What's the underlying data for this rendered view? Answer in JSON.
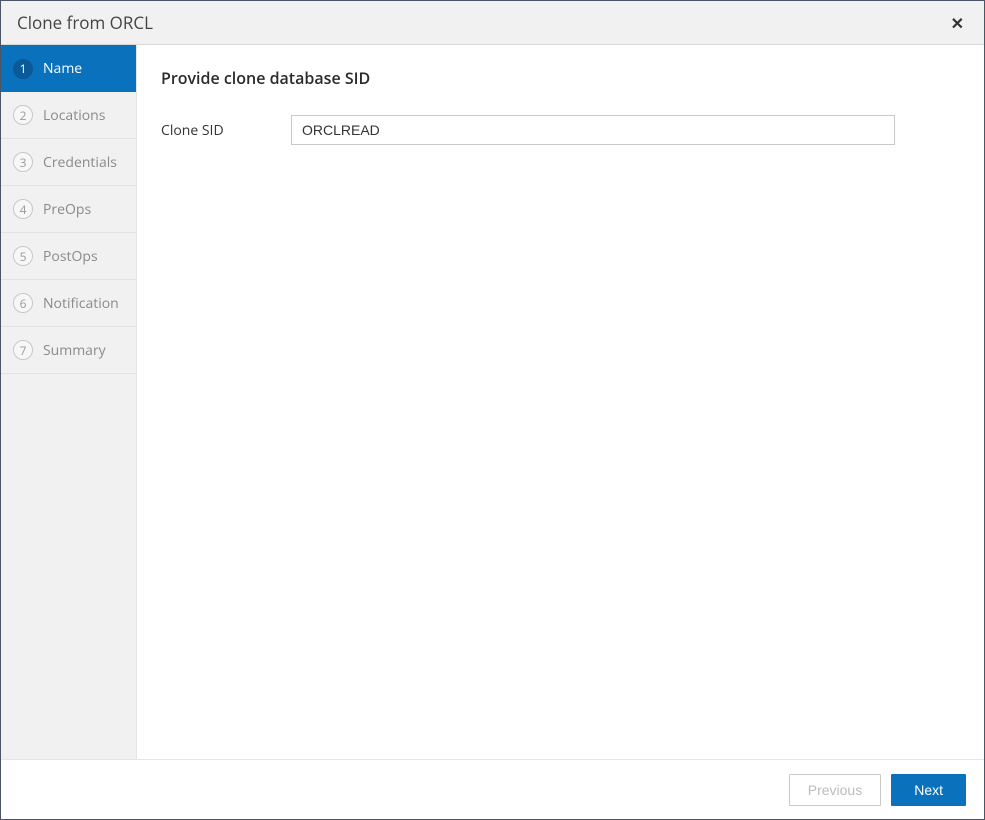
{
  "header": {
    "title": "Clone from ORCL"
  },
  "sidebar": {
    "items": [
      {
        "num": "1",
        "label": "Name"
      },
      {
        "num": "2",
        "label": "Locations"
      },
      {
        "num": "3",
        "label": "Credentials"
      },
      {
        "num": "4",
        "label": "PreOps"
      },
      {
        "num": "5",
        "label": "PostOps"
      },
      {
        "num": "6",
        "label": "Notification"
      },
      {
        "num": "7",
        "label": "Summary"
      }
    ]
  },
  "main": {
    "title": "Provide clone database SID",
    "clone_sid_label": "Clone SID",
    "clone_sid_value": "ORCLREAD"
  },
  "footer": {
    "previous_label": "Previous",
    "next_label": "Next"
  }
}
